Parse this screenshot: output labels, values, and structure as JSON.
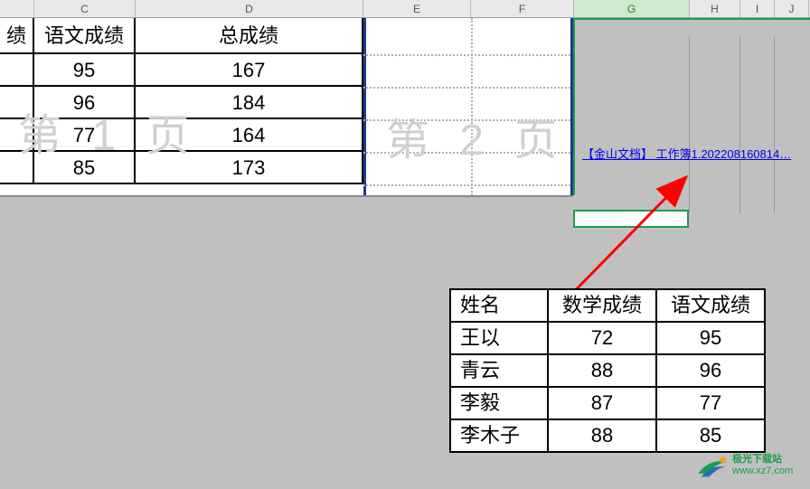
{
  "columns": {
    "c": "C",
    "d": "D",
    "e": "E",
    "f": "F",
    "g": "G",
    "h": "H",
    "i": "I",
    "j": "J"
  },
  "main_grid": {
    "header": {
      "b_partial": "绩",
      "c": "语文成绩",
      "d": "总成绩"
    },
    "rows": [
      {
        "c": "95",
        "d": "167"
      },
      {
        "c": "96",
        "d": "184"
      },
      {
        "c": "77",
        "d": "164"
      },
      {
        "c": "85",
        "d": "173"
      }
    ]
  },
  "watermarks": {
    "page1": "第 1 页",
    "page2": "第 2 页"
  },
  "hyperlink": {
    "text": "【金山文档】 工作簿1.202208160814…"
  },
  "inset_table": {
    "headers": [
      "姓名",
      "数学成绩",
      "语文成绩"
    ],
    "rows": [
      [
        "王以",
        "72",
        "95"
      ],
      [
        "青云",
        "88",
        "96"
      ],
      [
        "李毅",
        "87",
        "77"
      ],
      [
        "李木子",
        "88",
        "85"
      ]
    ]
  },
  "branding": {
    "name": "极光下载站",
    "url": "www.xz7.com"
  }
}
